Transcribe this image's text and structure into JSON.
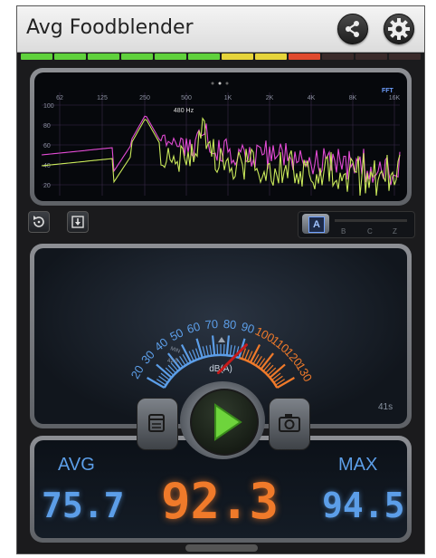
{
  "app": {
    "title": "Avg Foodblender"
  },
  "header": {
    "share_icon": "share-icon",
    "settings_icon": "gear-icon"
  },
  "level_bar": {
    "colors": [
      "#5fd13c",
      "#5fd13c",
      "#5fd13c",
      "#5fd13c",
      "#5fd13c",
      "#5fd13c",
      "#e6d43a",
      "#e6d43a",
      "#e04a2e",
      "#3a2a2a",
      "#3a2a2a",
      "#3a2a2a"
    ]
  },
  "fft": {
    "freq_labels": [
      "62",
      "125",
      "250",
      "500",
      "1K",
      "2K",
      "4K",
      "8K",
      "16K"
    ],
    "db_labels": [
      "100",
      "80",
      "60",
      "40",
      "20"
    ],
    "peak_label": "480 Hz",
    "mode_label": "FFT",
    "colors": {
      "pink": "#e24bd4",
      "yellow": "#c9e85a"
    }
  },
  "controls": {
    "reset_icon": "reset-icon",
    "save_icon": "save-icon",
    "weighting": {
      "selected": "A",
      "options": [
        "B",
        "C",
        "Z"
      ]
    }
  },
  "meter": {
    "scale_labels": [
      "20",
      "30",
      "40",
      "50",
      "60",
      "70",
      "80",
      "90",
      "100",
      "110",
      "120",
      "130"
    ],
    "unit": "dB(A)",
    "min_label": "MIN",
    "min_value": "42.5",
    "max_tick": "MAX",
    "elapsed": "41s",
    "needle_db": 92.3,
    "colors": {
      "blue": "#5c9ee8",
      "orange": "#f07a2a",
      "needle": "#c41a1a"
    }
  },
  "playback": {
    "play_icon": "play-icon",
    "log_icon": "log-icon",
    "camera_icon": "camera-icon"
  },
  "readout": {
    "avg_label": "AVG",
    "avg_value": "75.7",
    "current_value": "92.3",
    "max_label": "MAX",
    "max_value": "94.5"
  }
}
